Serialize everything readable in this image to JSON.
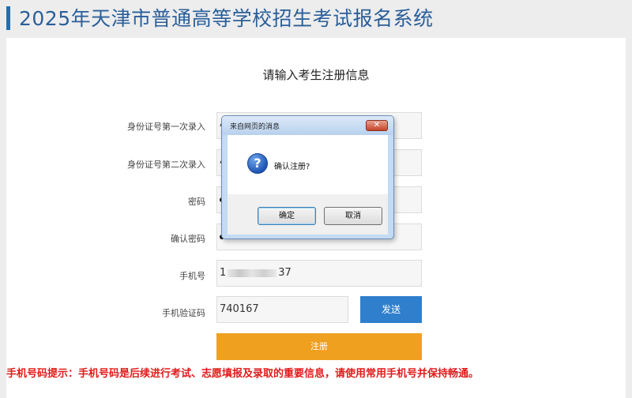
{
  "header": {
    "title": "2025年天津市普通高等学校招生考试报名系统"
  },
  "form": {
    "title": "请输入考生注册信息",
    "fields": [
      {
        "label": "身份证号第一次录入",
        "value": "4"
      },
      {
        "label": "身份证号第二次录入",
        "value": "4"
      },
      {
        "label": "密码",
        "value": ""
      },
      {
        "label": "确认密码",
        "value": ""
      },
      {
        "label": "手机号",
        "value_prefix": "1",
        "value_suffix": "37"
      },
      {
        "label": "手机验证码",
        "value": "740167"
      }
    ],
    "send_button": "发送",
    "register_button": "注册",
    "tip": "手机号码提示：手机号码是后续进行考试、志愿填报及录取的重要信息，请使用常用手机号并保持畅通。"
  },
  "dialog": {
    "title": "来自网页的消息",
    "close_symbol": "✕",
    "icon_symbol": "?",
    "message": "确认注册?",
    "ok_label": "确定",
    "cancel_label": "取消"
  },
  "colors": {
    "accent_blue": "#2f7fcc",
    "register_orange": "#eea01e",
    "tip_red": "#e11b1b",
    "header_text": "#2a5f9a"
  }
}
